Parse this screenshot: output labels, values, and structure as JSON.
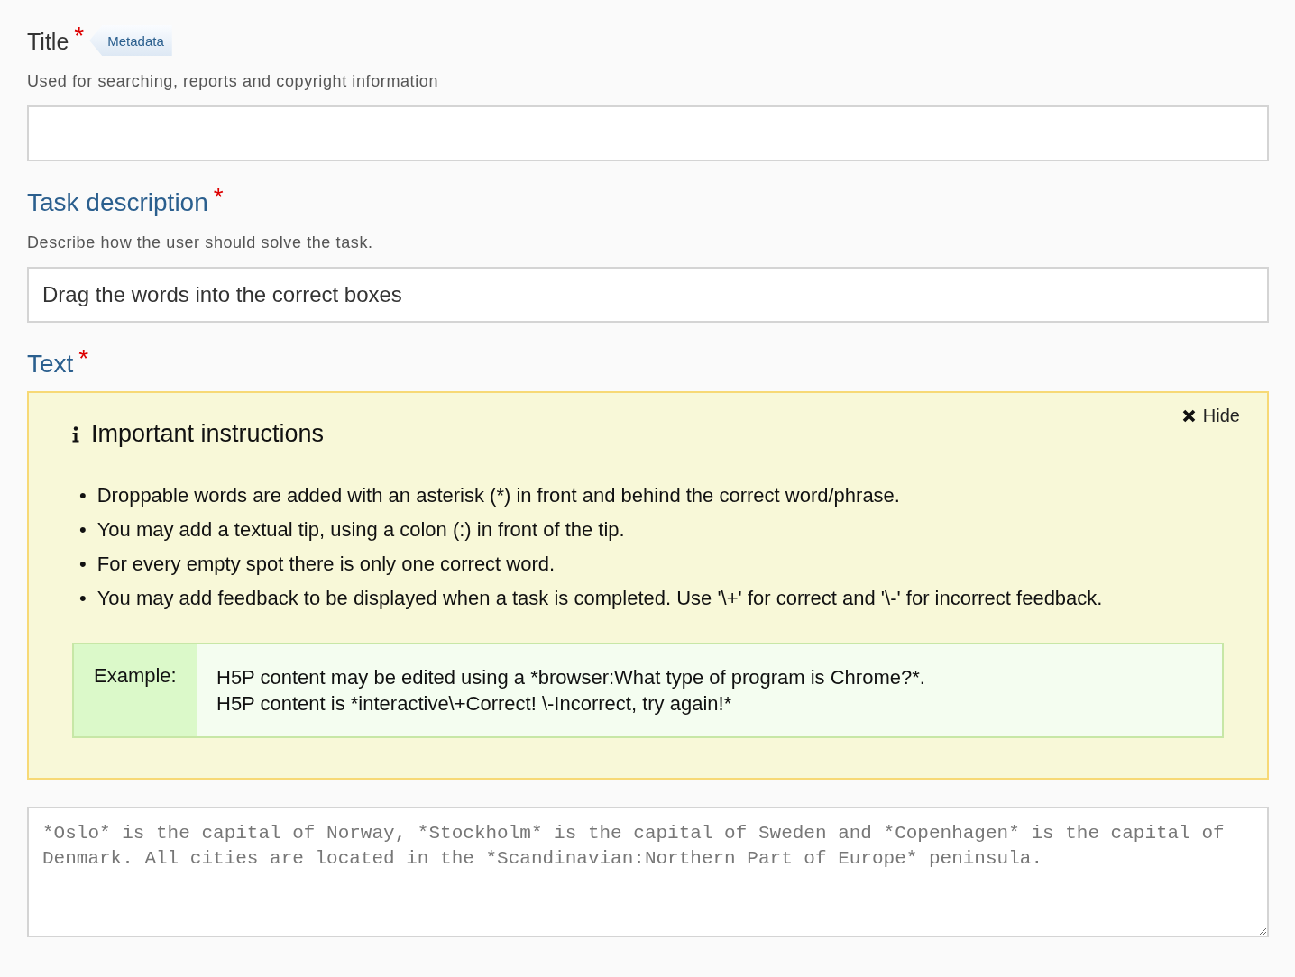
{
  "fields": [
    {
      "kind": "input",
      "label": "Title",
      "color": "#333333",
      "required_mark": "*",
      "metadata_button": "Metadata",
      "description": "Used for searching, reports and copyright information"
    },
    {
      "kind": "input",
      "label": "Task description",
      "color": "#2b5f8e",
      "required_mark": "*",
      "description": "Describe how the user should solve the task.",
      "value": "Drag the words into the correct boxes"
    },
    {
      "kind": "textarea",
      "label": "Text",
      "color": "#2b5f8e",
      "required_mark": "*",
      "instructions": {
        "title": "Important instructions",
        "hide_button": "Hide",
        "bullet_marker": "•",
        "bullets": [
          "Droppable words are added with an asterisk (*) in front and behind the correct word/phrase.",
          "You may add a textual tip, using a colon (:) in front of the tip.",
          "For every empty spot there is only one correct word.",
          "You may add feedback to be displayed when a task is completed. Use '\\+' for correct and '\\-' for incorrect feedback."
        ],
        "example_label": "Example:",
        "example_lines": [
          "H5P content may be edited using a *browser:What type of program is Chrome?*.",
          "H5P content is *interactive\\+Correct! \\-Incorrect, try again!*"
        ]
      },
      "placeholder": "*Oslo* is the capital of Norway, *Stockholm* is the capital of Sweden and *Copenhagen* is the capital of Denmark. All cities are located in the *Scandinavian:Northern Part of Europe* peninsula."
    }
  ]
}
